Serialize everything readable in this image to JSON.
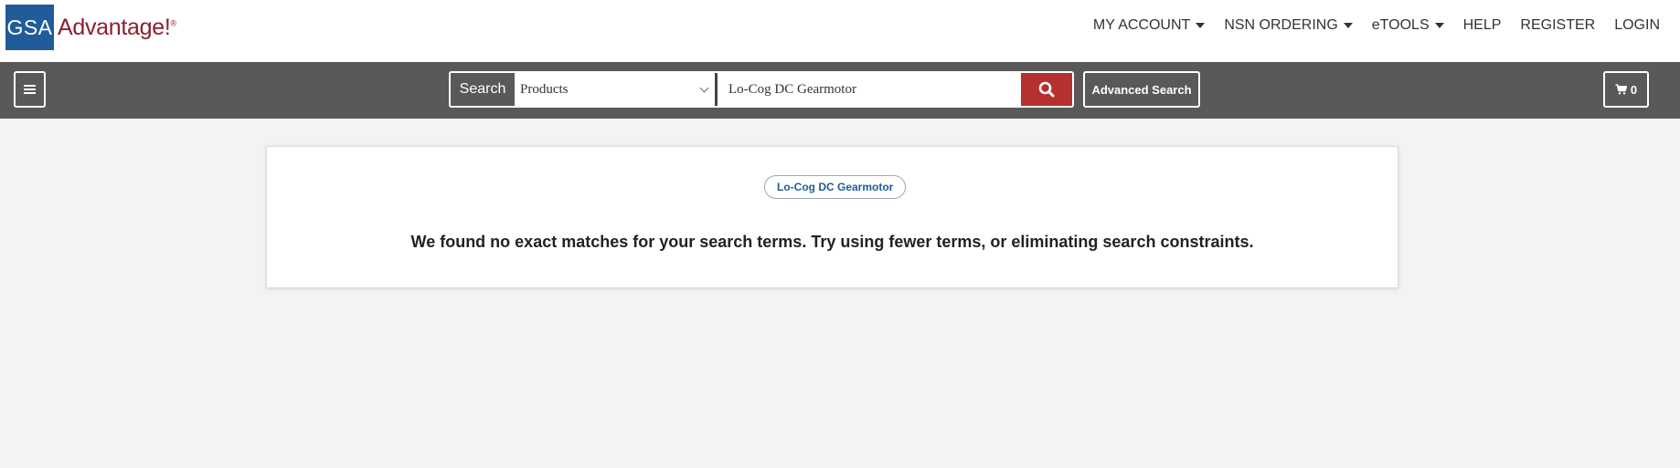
{
  "header": {
    "logo_gsa": "GSA",
    "logo_advantage": "Advantage!",
    "logo_reg": "®",
    "nav": [
      {
        "label": "MY ACCOUNT",
        "dropdown": true
      },
      {
        "label": "NSN ORDERING",
        "dropdown": true
      },
      {
        "label": "eTOOLS",
        "dropdown": true
      },
      {
        "label": "HELP",
        "dropdown": false
      },
      {
        "label": "REGISTER",
        "dropdown": false
      },
      {
        "label": "LOGIN",
        "dropdown": false
      }
    ]
  },
  "searchbar": {
    "label": "Search",
    "category_selected": "Products",
    "query_value": "Lo-Cog DC Gearmotor",
    "advanced_label": "Advanced Search",
    "cart_count": "0"
  },
  "results": {
    "term_chip": "Lo-Cog DC Gearmotor",
    "message": "We found no exact matches for your search terms. Try using fewer terms, or eliminating search constraints."
  },
  "colors": {
    "brand_blue": "#1f5c99",
    "brand_red": "#8b1f2e",
    "search_button": "#b5312f",
    "toolbar_bg": "#595959"
  },
  "icons": {
    "menu": "hamburger-icon",
    "search": "search-icon",
    "cart": "cart-icon",
    "dropdown": "chevron-down-icon"
  }
}
